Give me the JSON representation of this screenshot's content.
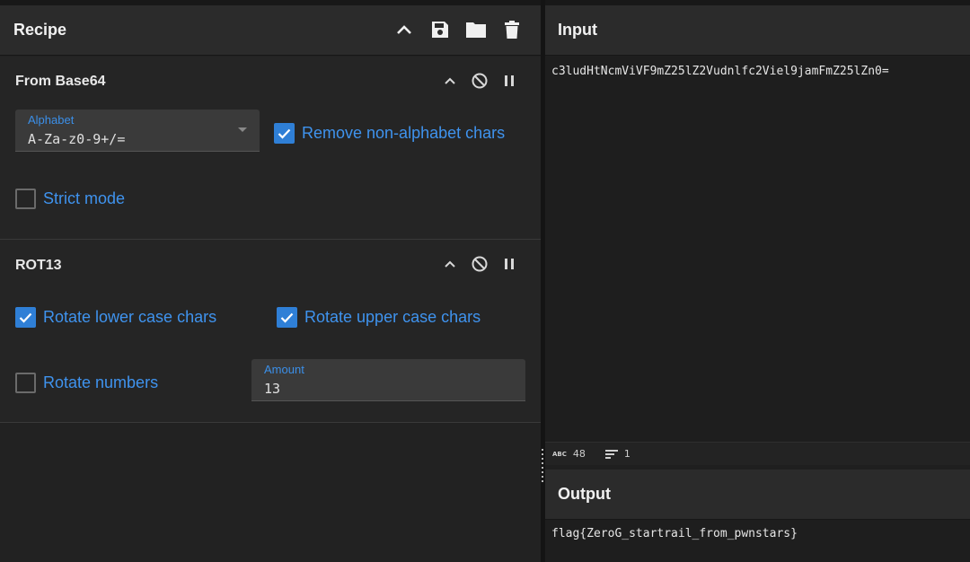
{
  "recipe": {
    "title": "Recipe",
    "tools": [
      "chevron-up-icon",
      "save-icon",
      "folder-icon",
      "trash-icon"
    ]
  },
  "operations": {
    "from_base64": {
      "title": "From Base64",
      "alphabet_label": "Alphabet",
      "alphabet_value": "A-Za-z0-9+/=",
      "remove_non_alphabet": "Remove non-alphabet chars",
      "remove_non_alphabet_checked": true,
      "strict_mode": "Strict mode",
      "strict_mode_checked": false
    },
    "rot13": {
      "title": "ROT13",
      "rotate_lower": "Rotate lower case chars",
      "rotate_lower_checked": true,
      "rotate_upper": "Rotate upper case chars",
      "rotate_upper_checked": true,
      "rotate_numbers": "Rotate numbers",
      "rotate_numbers_checked": false,
      "amount_label": "Amount",
      "amount_value": "13"
    }
  },
  "input": {
    "title": "Input",
    "text": "c3ludHtNcmViVF9mZ25lZ2Vudnlfc2Viel9jamFmZ25lZn0=",
    "length": "48",
    "lines": "1"
  },
  "output": {
    "title": "Output",
    "text": "flag{ZeroG_startrail_from_pwnstars}"
  },
  "colors": {
    "accent": "#2f7fd6",
    "label": "#3f93ee"
  }
}
